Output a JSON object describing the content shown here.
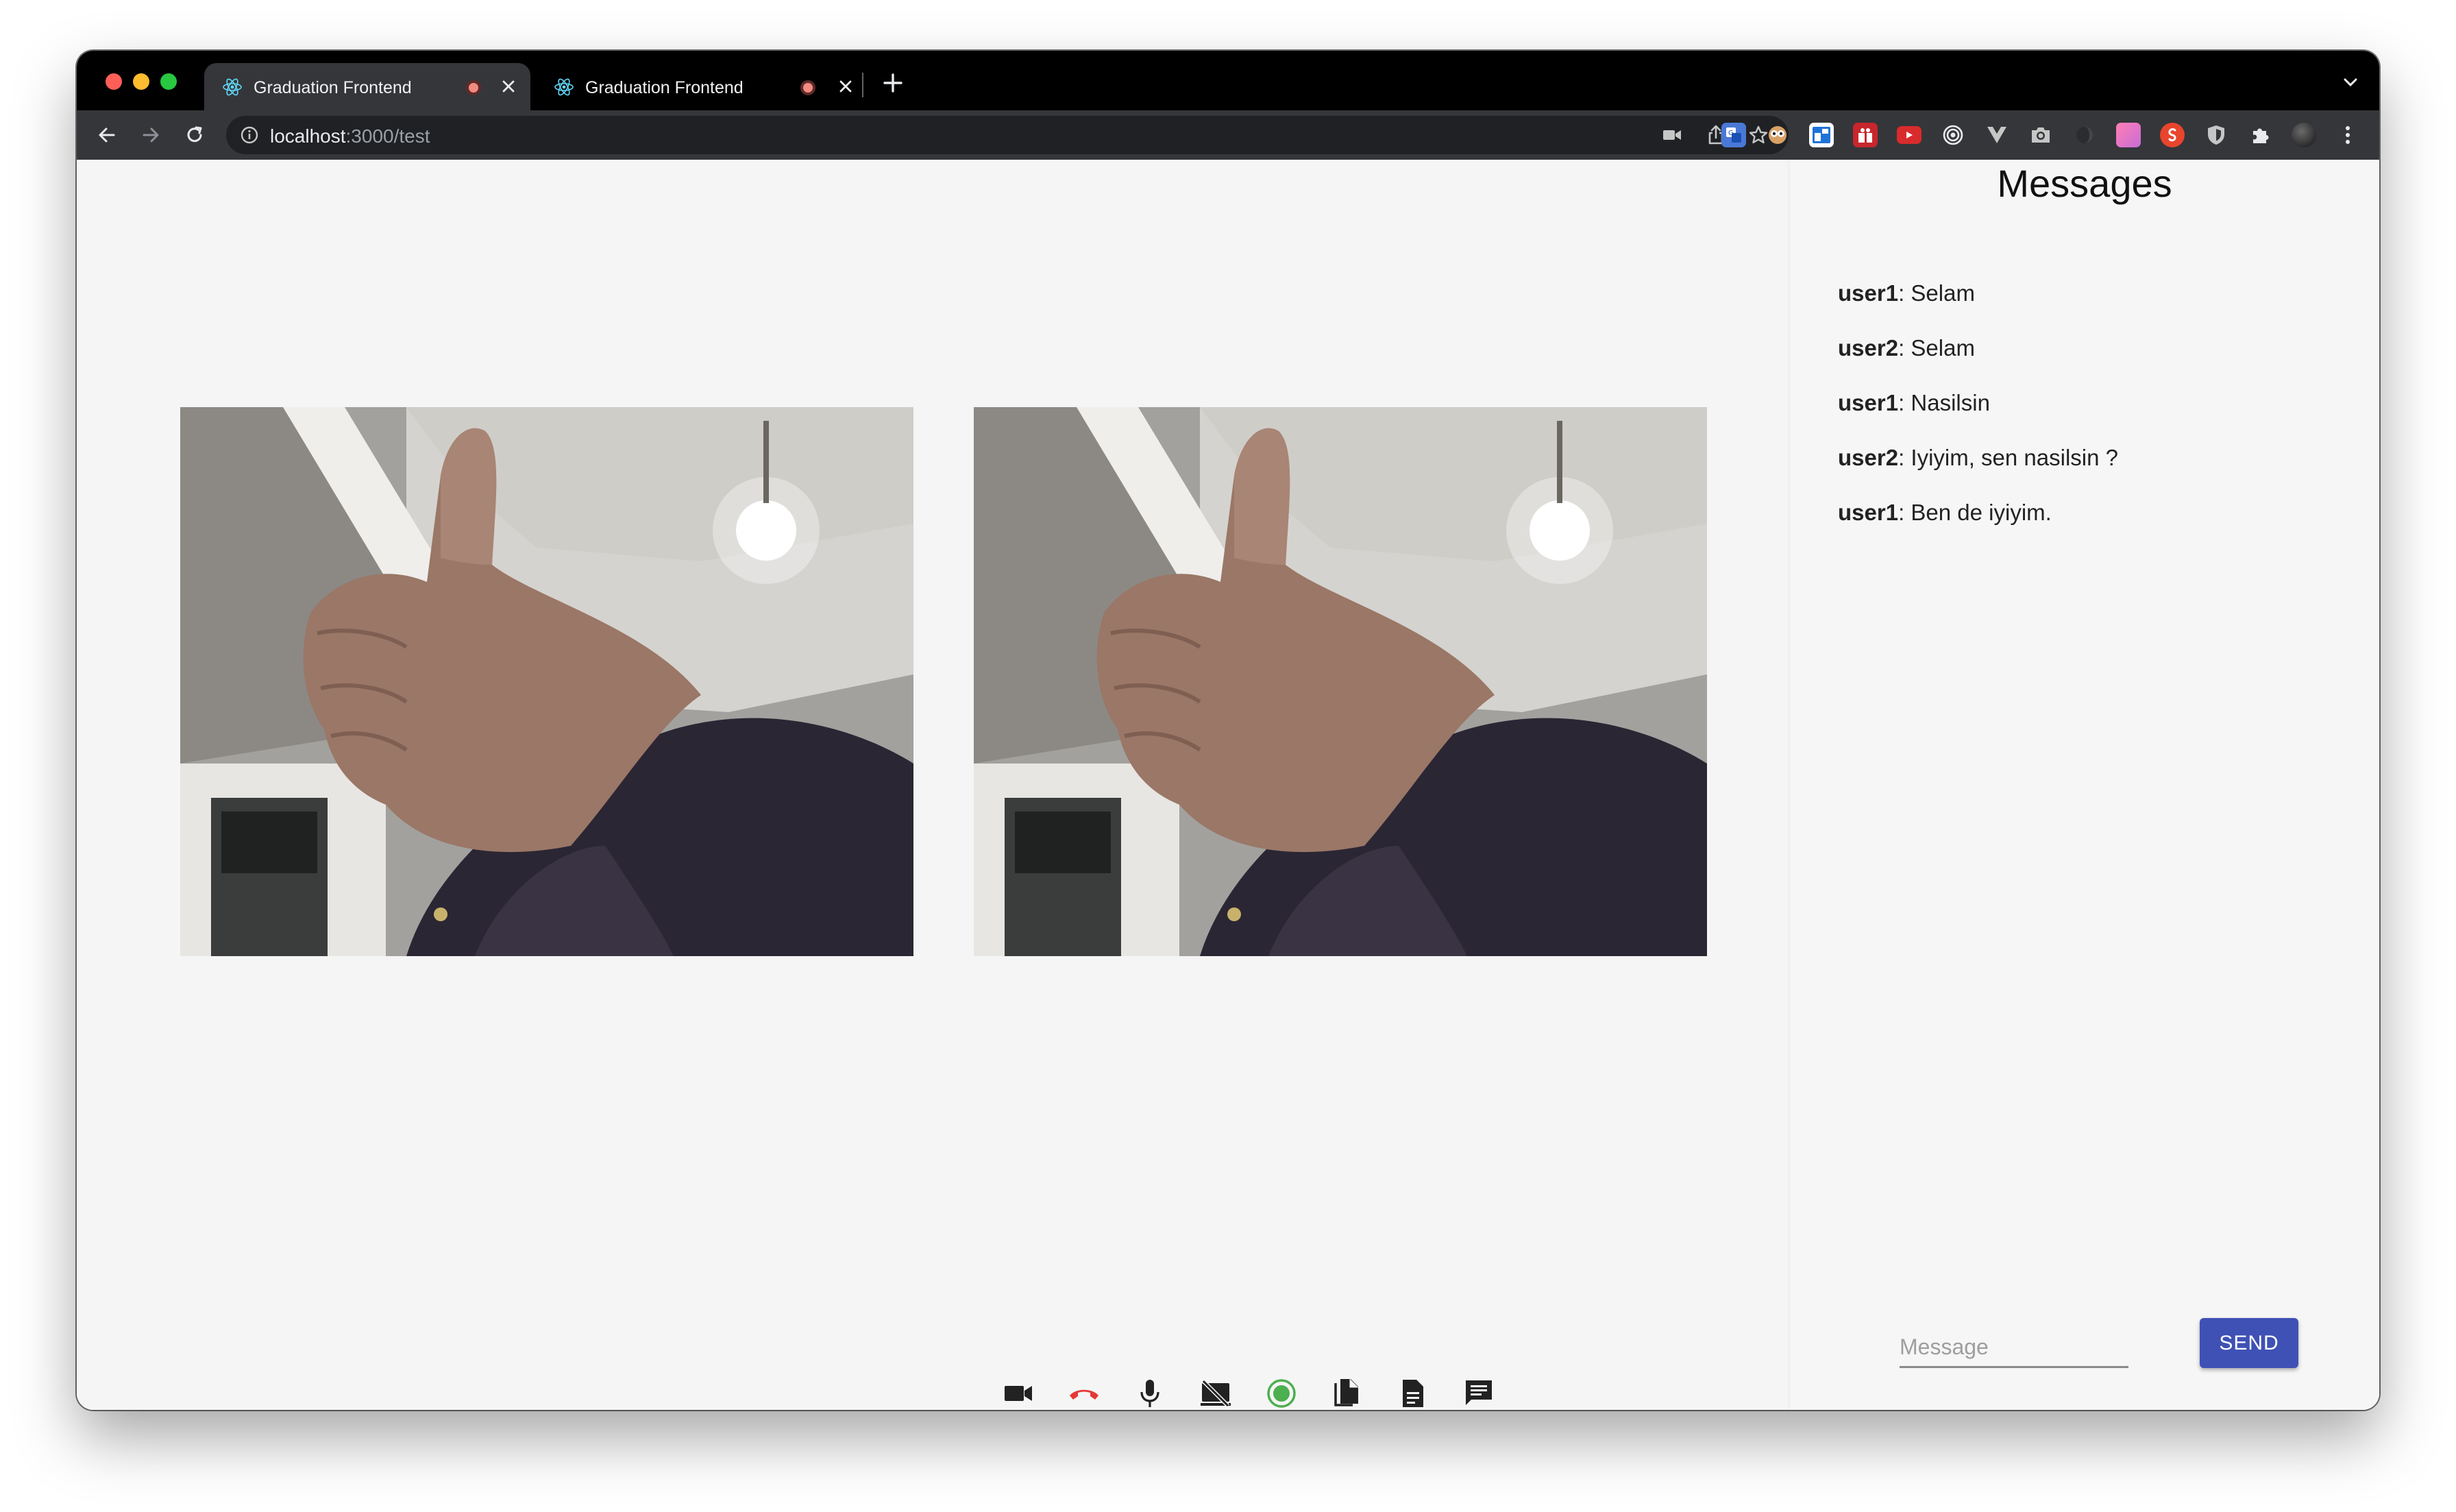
{
  "browser": {
    "tabs": [
      {
        "title": "Graduation Frontend",
        "active": true,
        "favicon": "react-logo-icon",
        "recording": true
      },
      {
        "title": "Graduation Frontend",
        "active": false,
        "favicon": "react-logo-icon",
        "recording": true
      }
    ],
    "address": {
      "host": "localhost",
      "path": ":3000/test"
    },
    "colors": {
      "tabstrip": "#000000",
      "toolbar": "#35363a",
      "omnibox": "#202124"
    }
  },
  "videos": [
    {
      "name": "local-video",
      "icon": "camera-feed-thumbs-up"
    },
    {
      "name": "remote-video",
      "icon": "camera-feed-thumbs-up"
    }
  ],
  "controls": [
    {
      "name": "camera-toggle-button",
      "icon": "videocam-icon"
    },
    {
      "name": "hang-up-button",
      "icon": "call-end-icon",
      "color": "#e53935"
    },
    {
      "name": "mic-toggle-button",
      "icon": "mic-icon"
    },
    {
      "name": "screen-share-toggle-button",
      "icon": "stop-screen-share-icon"
    },
    {
      "name": "record-button",
      "icon": "record-icon",
      "color": "#4caf50"
    },
    {
      "name": "files-button",
      "icon": "file-copy-icon"
    },
    {
      "name": "document-button",
      "icon": "description-icon"
    },
    {
      "name": "chat-button",
      "icon": "chat-icon"
    }
  ],
  "chat": {
    "title": "Messages",
    "messages": [
      {
        "user": "user1",
        "text": ": Selam"
      },
      {
        "user": "user2",
        "text": ": Selam"
      },
      {
        "user": "user1",
        "text": ": Nasilsin"
      },
      {
        "user": "user2",
        "text": ": Iyiyim, sen nasilsin ?"
      },
      {
        "user": "user1",
        "text": ": Ben de iyiyim."
      }
    ],
    "input_placeholder": "Message",
    "input_value": "",
    "send_label": "SEND",
    "send_color": "#3f51b5"
  }
}
